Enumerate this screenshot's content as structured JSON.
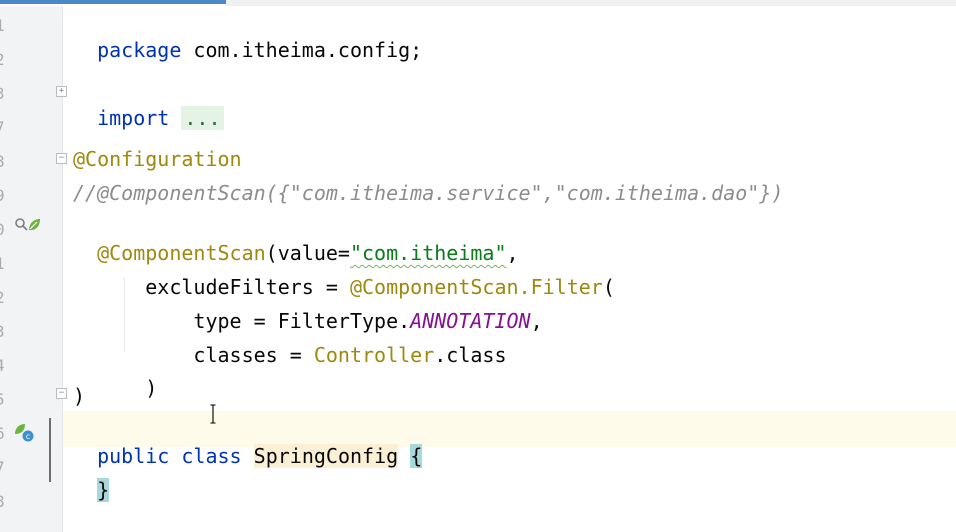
{
  "gutter": {
    "line_numbers": [
      "1",
      "2",
      "3",
      "7",
      "8",
      "9",
      "0",
      "1",
      "2",
      "3",
      "4",
      "5",
      "6",
      "7",
      "8"
    ]
  },
  "code": {
    "line_package": {
      "kw": "package",
      "rest": " com.itheima.config;"
    },
    "line_import": {
      "kw": "import",
      "folded": "..."
    },
    "line_configuration": "@Configuration",
    "line_comment": "//@ComponentScan({\"com.itheima.service\",\"com.itheima.dao\"})",
    "line_scan": {
      "ann": "@ComponentScan",
      "open": "(value=",
      "str": "\"com.itheima\"",
      "close": ","
    },
    "line_exclude": {
      "indent": "    ",
      "text": "excludeFilters = ",
      "ann": "@ComponentScan.Filter",
      "open": "("
    },
    "line_type": {
      "indent": "        ",
      "text": "type = FilterType.",
      "const": "ANNOTATION",
      "close": ","
    },
    "line_classes": {
      "indent": "        ",
      "text": "classes = ",
      "cls": "Controller",
      "rest": ".class"
    },
    "line_paren_inner": {
      "indent": "    ",
      "text": ")"
    },
    "line_paren_outer": ")",
    "line_class_decl": {
      "kw1": "public",
      "kw2": "class",
      "name": "SpringConfig",
      "brace": "{"
    },
    "line_close_brace": "}"
  },
  "icons": {
    "scan_gutter": "bean-scan-icon",
    "class_gutter": "spring-bean-icon"
  },
  "colors": {
    "keyword": "#0033b3",
    "annotation": "#9e880d",
    "string": "#067d17",
    "comment": "#8c8c8c",
    "constant": "#871094"
  }
}
